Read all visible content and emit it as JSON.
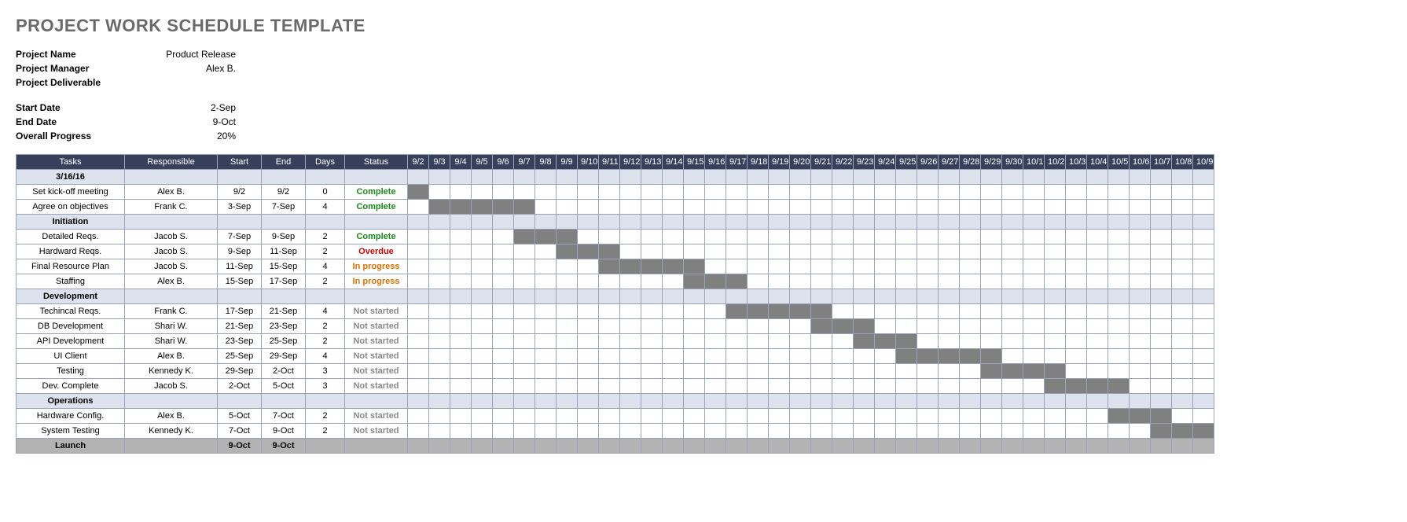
{
  "title": "PROJECT WORK SCHEDULE TEMPLATE",
  "meta": {
    "project_name_label": "Project Name",
    "project_name": "Product Release",
    "project_manager_label": "Project Manager",
    "project_manager": "Alex B.",
    "project_deliverable_label": "Project Deliverable",
    "project_deliverable": "",
    "start_date_label": "Start Date",
    "start_date": "2-Sep",
    "end_date_label": "End Date",
    "end_date": "9-Oct",
    "overall_progress_label": "Overall Progress",
    "overall_progress": "20%"
  },
  "headers": {
    "tasks": "Tasks",
    "responsible": "Responsible",
    "start": "Start",
    "end": "End",
    "days": "Days",
    "status": "Status"
  },
  "dates": [
    "9/2",
    "9/3",
    "9/4",
    "9/5",
    "9/6",
    "9/7",
    "9/8",
    "9/9",
    "9/10",
    "9/11",
    "9/12",
    "9/13",
    "9/14",
    "9/15",
    "9/16",
    "9/17",
    "9/18",
    "9/19",
    "9/20",
    "9/21",
    "9/22",
    "9/23",
    "9/24",
    "9/25",
    "9/26",
    "9/27",
    "9/28",
    "9/29",
    "9/30",
    "10/1",
    "10/2",
    "10/3",
    "10/4",
    "10/5",
    "10/6",
    "10/7",
    "10/8",
    "10/9"
  ],
  "status_classes": {
    "Complete": "s-complete",
    "Overdue": "s-overdue",
    "In progress": "s-inprogress",
    "Not started": "s-notstarted"
  },
  "rows": [
    {
      "type": "section",
      "label": "3/16/16"
    },
    {
      "type": "task",
      "task": "Set kick-off meeting",
      "resp": "Alex B.",
      "start": "9/2",
      "end": "9/2",
      "days": "0",
      "status": "Complete",
      "bar_from": 0,
      "bar_to": 0
    },
    {
      "type": "task",
      "task": "Agree on objectives",
      "resp": "Frank C.",
      "start": "3-Sep",
      "end": "7-Sep",
      "days": "4",
      "status": "Complete",
      "bar_from": 1,
      "bar_to": 5
    },
    {
      "type": "section",
      "label": "Initiation"
    },
    {
      "type": "task",
      "task": "Detailed Reqs.",
      "resp": "Jacob S.",
      "start": "7-Sep",
      "end": "9-Sep",
      "days": "2",
      "status": "Complete",
      "bar_from": 5,
      "bar_to": 7
    },
    {
      "type": "task",
      "task": "Hardward Reqs.",
      "resp": "Jacob S.",
      "start": "9-Sep",
      "end": "11-Sep",
      "days": "2",
      "status": "Overdue",
      "bar_from": 7,
      "bar_to": 9
    },
    {
      "type": "task",
      "task": "Final Resource Plan",
      "resp": "Jacob S.",
      "start": "11-Sep",
      "end": "15-Sep",
      "days": "4",
      "status": "In progress",
      "bar_from": 9,
      "bar_to": 13
    },
    {
      "type": "task",
      "task": "Staffing",
      "resp": "Alex B.",
      "start": "15-Sep",
      "end": "17-Sep",
      "days": "2",
      "status": "In progress",
      "bar_from": 13,
      "bar_to": 15
    },
    {
      "type": "section",
      "label": "Development"
    },
    {
      "type": "task",
      "task": "Techincal Reqs.",
      "resp": "Frank C.",
      "start": "17-Sep",
      "end": "21-Sep",
      "days": "4",
      "status": "Not started",
      "bar_from": 15,
      "bar_to": 19
    },
    {
      "type": "task",
      "task": "DB Development",
      "resp": "Shari W.",
      "start": "21-Sep",
      "end": "23-Sep",
      "days": "2",
      "status": "Not started",
      "bar_from": 19,
      "bar_to": 21
    },
    {
      "type": "task",
      "task": "API Development",
      "resp": "Shari W.",
      "start": "23-Sep",
      "end": "25-Sep",
      "days": "2",
      "status": "Not started",
      "bar_from": 21,
      "bar_to": 23
    },
    {
      "type": "task",
      "task": "UI Client",
      "resp": "Alex B.",
      "start": "25-Sep",
      "end": "29-Sep",
      "days": "4",
      "status": "Not started",
      "bar_from": 23,
      "bar_to": 27
    },
    {
      "type": "task",
      "task": "Testing",
      "resp": "Kennedy K.",
      "start": "29-Sep",
      "end": "2-Oct",
      "days": "3",
      "status": "Not started",
      "bar_from": 27,
      "bar_to": 30
    },
    {
      "type": "task",
      "task": "Dev. Complete",
      "resp": "Jacob S.",
      "start": "2-Oct",
      "end": "5-Oct",
      "days": "3",
      "status": "Not started",
      "bar_from": 30,
      "bar_to": 33
    },
    {
      "type": "section",
      "label": "Operations"
    },
    {
      "type": "task",
      "task": "Hardware Config.",
      "resp": "Alex B.",
      "start": "5-Oct",
      "end": "7-Oct",
      "days": "2",
      "status": "Not started",
      "bar_from": 33,
      "bar_to": 35
    },
    {
      "type": "task",
      "task": "System Testing",
      "resp": "Kennedy K.",
      "start": "7-Oct",
      "end": "9-Oct",
      "days": "2",
      "status": "Not started",
      "bar_from": 35,
      "bar_to": 37
    },
    {
      "type": "launch",
      "label": "Launch",
      "start": "9-Oct",
      "end": "9-Oct"
    }
  ]
}
